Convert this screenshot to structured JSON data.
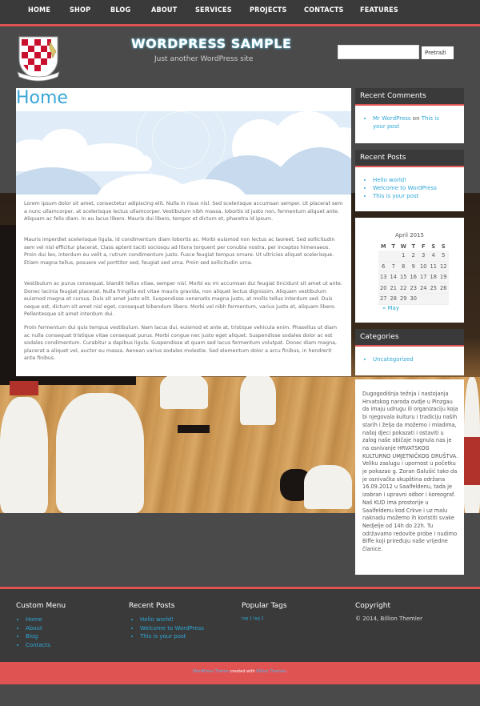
{
  "nav": {
    "items": [
      "HOME",
      "SHOP",
      "BLOG",
      "ABOUT",
      "SERVICES",
      "PROJECTS",
      "CONTACTS",
      "FEATURES"
    ]
  },
  "header": {
    "title": "WORDPRESS SAMPLE",
    "tagline": "Just another WordPress site",
    "search_button": "Pretraži"
  },
  "main": {
    "page_title": "Home",
    "paragraphs": [
      "Lorem ipsum dolor sit amet, consectetur adipiscing elit. Nulla in risus nisl. Sed scelerisque accumsan semper. Ut placerat sem a nunc ullamcorper, at scelerisque lectus ullamcorper. Vestibulum nibh massa, lobortis id justo non, fermentum aliquet ante. Aliquam ac felis diam. In eu lacus libero. Mauris dui libero, tempor et dictum et, pharetra id ipsum.",
      "Mauris imperdiet scelerisque ligula, id condimentum diam lobortis ac. Morbi euismod non lectus ac laoreet. Sed sollicitudin sem vel nisl efficitur placerat. Class aptent taciti sociosqu ad litora torquent per conubia nostra, per inceptos himenaeos. Proin dui leo, interdum eu velit a, rutrum condimentum justo. Fusce feugiat tempus ornare. Ut ultricies aliquet scelerisque. Etiam magna tellus, posuere vel porttitor sed, feugiat sed urna. Proin sed sollicitudin urna.",
      "Vestibulum ac purus consequat, blandit tellus vitae, semper nisl. Morbi eu mi accumsan dui feugiat tincidunt sit amet ut ante. Donec lacinia feugiat placerat. Nulla fringilla est vitae mauris gravida, non aliquet lectus dignissim. Aliquam vestibulum euismod magna et cursus. Duis sit amet justo elit. Suspendisse venenatis magna justo, at mollis tellus interdum sed. Duis neque est, dictum sit amet nisl eget, consequat bibendum libero. Morbi vel nibh fermentum, varius justo et, aliquam libero. Pellentesque sit amet interdum dui.",
      "Proin fermentum dui quis tempus vestibulum. Nam lacus dui, euismod et ante at, tristique vehicula enim. Phasellus ut diam ac nulla consequat tristique vitae consequat purus. Morbi congue nec justo eget aliquet. Suspendisse sodales dolor ac est sodales condimentum. Curabitur a dapibus ligula. Suspendisse at quam sed lacus fermentum volutpat. Donec diam magna, placerat a aliquet vel, auctor eu massa. Aenean varius sodales molestie. Sed elementum dolor a arcu finibus, in hendrerit ante finibus."
    ]
  },
  "sidebar": {
    "recent_comments": {
      "title": "Recent Comments",
      "author": "Mr WordPress",
      "on": "on",
      "post": "This is your post"
    },
    "recent_posts": {
      "title": "Recent Posts",
      "items": [
        "Hello world!",
        "Welcome to WordPress",
        "This is your post"
      ]
    },
    "calendar": {
      "month": "April 2015",
      "weekdays": [
        "M",
        "T",
        "W",
        "T",
        "F",
        "S",
        "S"
      ],
      "rows": [
        [
          "",
          "",
          "1",
          "2",
          "3",
          "4",
          "5"
        ],
        [
          "6",
          "7",
          "8",
          "9",
          "10",
          "11",
          "12"
        ],
        [
          "13",
          "14",
          "15",
          "16",
          "17",
          "18",
          "19"
        ],
        [
          "20",
          "21",
          "22",
          "23",
          "24",
          "25",
          "26"
        ],
        [
          "27",
          "28",
          "29",
          "30",
          "",
          "",
          ""
        ]
      ],
      "prev": "« May"
    },
    "categories": {
      "title": "Categories",
      "items": [
        "Uncategorized"
      ]
    },
    "about": "Dugogodišnja težnja i nastojanja Hrvatskog naroda ovdje u Pinzgau da imaju udrugu ili organizaciju koja bi njegovala kulturu i tradiciju naših starih i želja da možemo i mladima, našoj djeci pokazati i ostaviti u zalog naše običaje nagnula nas je na osnivanje HRVATSKOG KULTURNO UMJETNIČKOG DRUŠTVA. Veliku zaslugu i upornost u početku je pokazao g. Zoran Galušić tako da je osnivačka skupština održana 16.09.2012 u Saalfeldenu, tada je izabran i upravni odbor i koreograf. Naš KUD ima prostorije u Saalfeldenu kod Crkve i uz malu naknadu možemo ih koristiti svake Nedjelje od 14h do 22h. Tu održavamo redovite probe i nudimo Biffe koji priređuju naše vrijedne članice."
  },
  "footer": {
    "custom_menu": {
      "title": "Custom Menu",
      "items": [
        "Home",
        "About",
        "Blog",
        "Contacts"
      ]
    },
    "recent_posts": {
      "title": "Recent Posts",
      "items": [
        "Hello world!",
        "Welcome to WordPress",
        "This is your post"
      ]
    },
    "tags": {
      "title": "Popular Tags",
      "items": [
        "tag 1",
        "tag 2"
      ]
    },
    "copyright": {
      "title": "Copyright",
      "text": "© 2014, Billion Themler"
    },
    "credits": {
      "link1": "WordPress Theme",
      "middle": " created with ",
      "link2": "Billion Themler",
      "end": "."
    }
  },
  "colors": {
    "accent": "#e05353",
    "link": "#2ea6d6",
    "dark": "#3a3a3a",
    "background": "#4a4a4a"
  }
}
